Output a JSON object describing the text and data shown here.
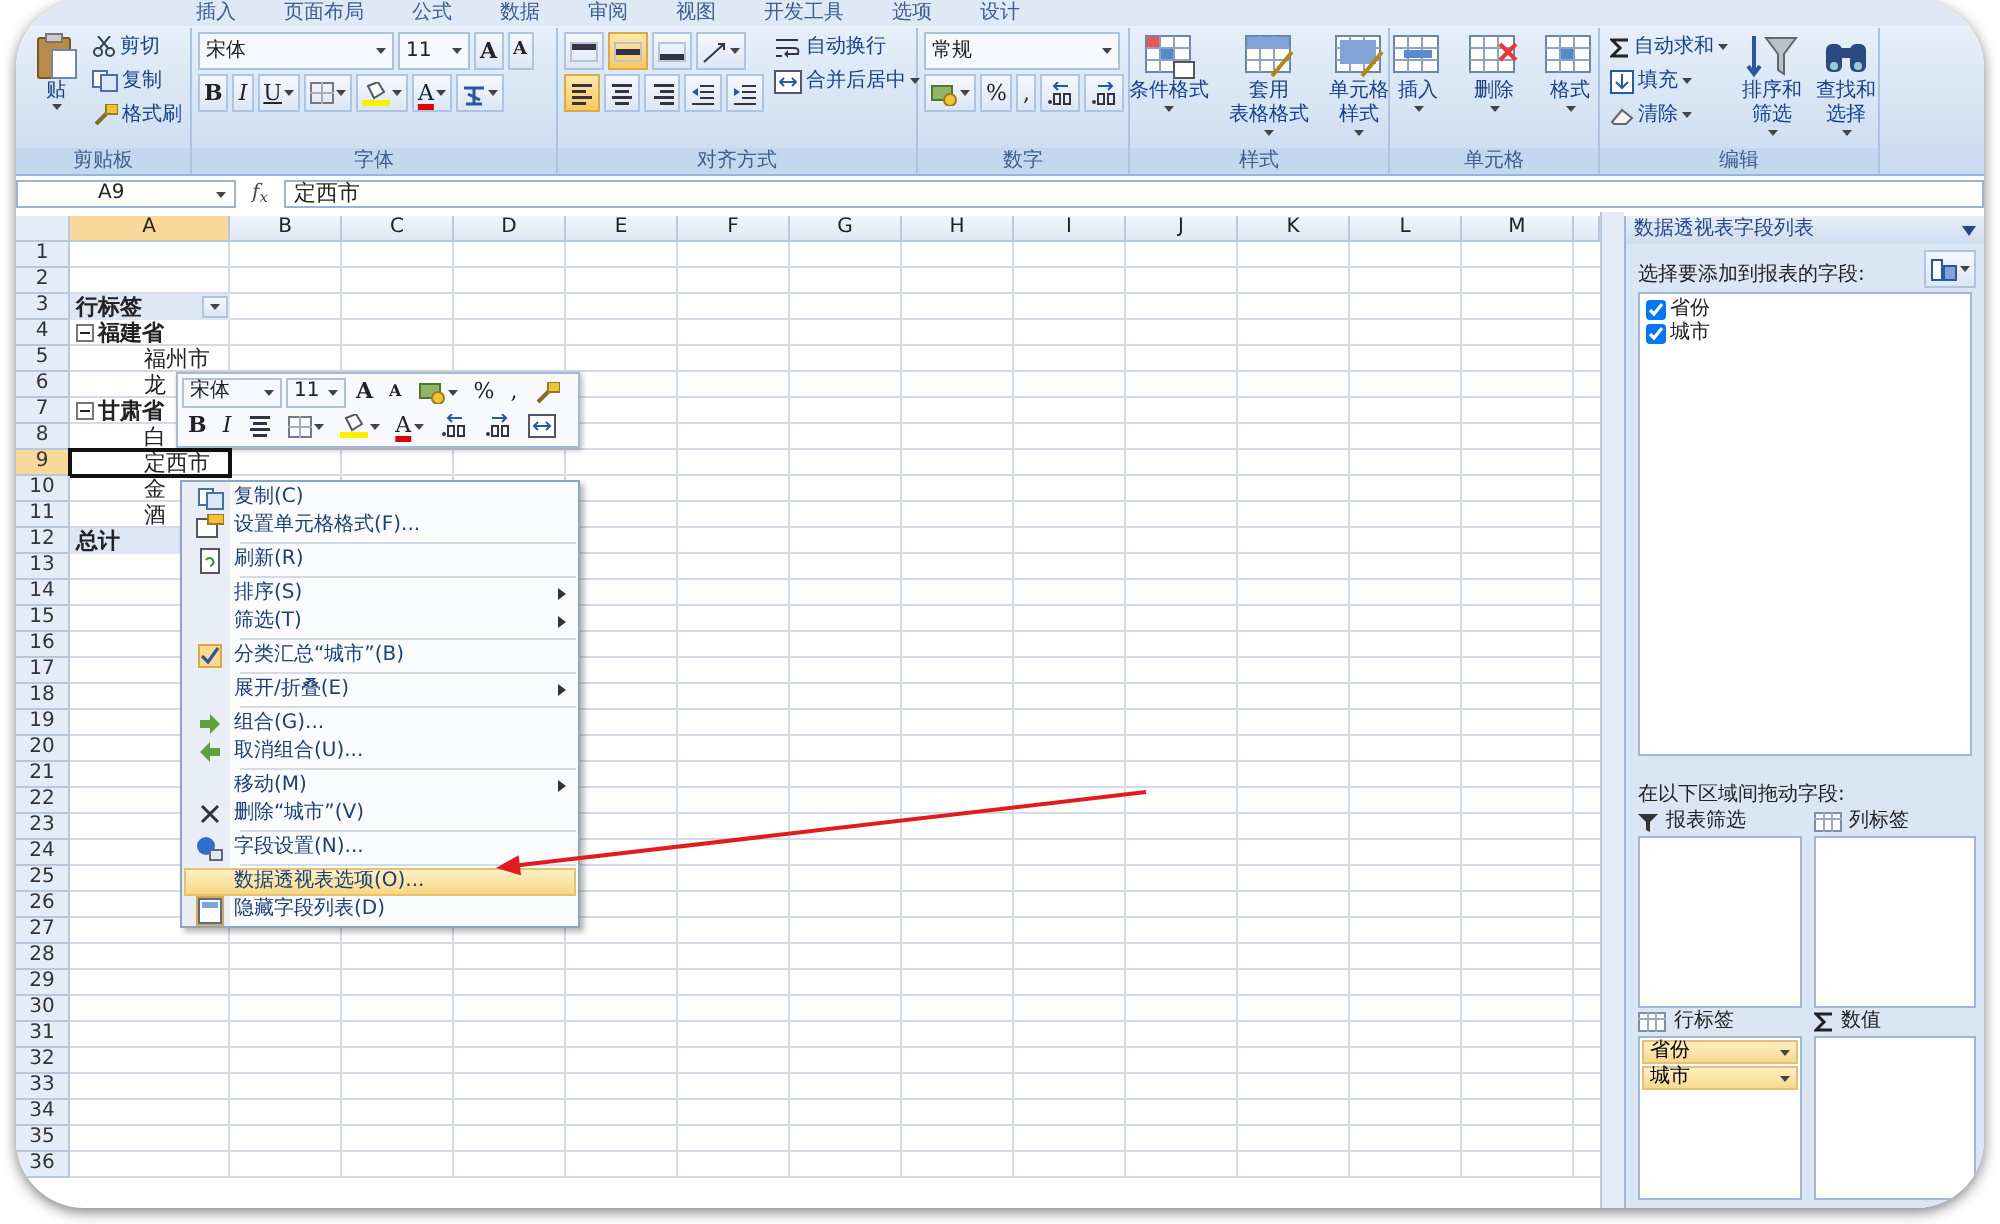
{
  "ribbon_tabs": [
    {
      "label": "插入",
      "selected": false
    },
    {
      "label": "页面布局",
      "selected": false
    },
    {
      "label": "公式",
      "selected": false
    },
    {
      "label": "数据",
      "selected": false
    },
    {
      "label": "审阅",
      "selected": false
    },
    {
      "label": "视图",
      "selected": false
    },
    {
      "label": "开发工具",
      "selected": false
    },
    {
      "label": "选项",
      "selected": false
    },
    {
      "label": "设计",
      "selected": false
    }
  ],
  "clipboard": {
    "label": "剪贴板",
    "paste": "贴",
    "cut": "剪切",
    "copy": "复制",
    "format_painter": "格式刷"
  },
  "font": {
    "label": "字体",
    "font_name": "宋体",
    "font_size": "11",
    "grow": "A",
    "shrink": "A",
    "bold": "B",
    "italic": "I",
    "underline": "U",
    "font_color_label": "A"
  },
  "alignment": {
    "label": "对齐方式",
    "wrap": "自动换行",
    "merge": "合并后居中",
    "vertical_align": [
      {
        "selected": false
      },
      {
        "selected": true
      },
      {
        "selected": false
      }
    ],
    "horizontal_align": [
      {
        "selected": true
      },
      {
        "selected": false
      },
      {
        "selected": false
      }
    ]
  },
  "number": {
    "label": "数字",
    "format": "常规",
    "percent": "%",
    "comma": ","
  },
  "styles": {
    "label": "样式",
    "buttons": [
      {
        "lines": [
          "条件格式"
        ]
      },
      {
        "lines": [
          "套用",
          "表格格式"
        ]
      },
      {
        "lines": [
          "单元格",
          "样式"
        ]
      }
    ]
  },
  "cells": {
    "label": "单元格",
    "buttons": [
      {
        "lines": [
          "插入"
        ]
      },
      {
        "lines": [
          "删除"
        ]
      },
      {
        "lines": [
          "格式"
        ]
      }
    ]
  },
  "editing": {
    "label": "编辑",
    "small": [
      "自动求和",
      "填充",
      "清除"
    ],
    "large": [
      {
        "lines": [
          "排序和",
          "筛选"
        ]
      },
      {
        "lines": [
          "查找和",
          "选择"
        ]
      }
    ]
  },
  "formula_bar": {
    "name_box": "A9",
    "fx": "f$_{x}$",
    "value": "定西市"
  },
  "sheet": {
    "columns": [
      {
        "label": "A",
        "selected": true
      },
      {
        "label": "B",
        "selected": false
      },
      {
        "label": "C",
        "selected": false
      },
      {
        "label": "D",
        "selected": false
      },
      {
        "label": "E",
        "selected": false
      },
      {
        "label": "F",
        "selected": false
      },
      {
        "label": "G",
        "selected": false
      },
      {
        "label": "H",
        "selected": false
      },
      {
        "label": "I",
        "selected": false
      },
      {
        "label": "J",
        "selected": false
      },
      {
        "label": "K",
        "selected": false
      },
      {
        "label": "L",
        "selected": false
      },
      {
        "label": "M",
        "selected": false
      }
    ],
    "rows": [
      {
        "number": "1",
        "selected": false
      },
      {
        "number": "2",
        "selected": false
      },
      {
        "number": "3",
        "selected": false
      },
      {
        "number": "4",
        "selected": false
      },
      {
        "number": "5",
        "selected": false
      },
      {
        "number": "6",
        "selected": false
      },
      {
        "number": "7",
        "selected": false
      },
      {
        "number": "8",
        "selected": false
      },
      {
        "number": "9",
        "selected": true
      },
      {
        "number": "10",
        "selected": false
      },
      {
        "number": "11",
        "selected": false
      },
      {
        "number": "12",
        "selected": false
      },
      {
        "number": "13",
        "selected": false
      },
      {
        "number": "14",
        "selected": false
      },
      {
        "number": "15",
        "selected": false
      },
      {
        "number": "16",
        "selected": false
      },
      {
        "number": "17",
        "selected": false
      },
      {
        "number": "18",
        "selected": false
      },
      {
        "number": "19",
        "selected": false
      },
      {
        "number": "20",
        "selected": false
      },
      {
        "number": "21",
        "selected": false
      },
      {
        "number": "22",
        "selected": false
      },
      {
        "number": "23",
        "selected": false
      },
      {
        "number": "24",
        "selected": false
      },
      {
        "number": "25",
        "selected": false
      },
      {
        "number": "26",
        "selected": false
      },
      {
        "number": "27",
        "selected": false
      },
      {
        "number": "28",
        "selected": false
      },
      {
        "number": "29",
        "selected": false
      },
      {
        "number": "30",
        "selected": false
      },
      {
        "number": "31",
        "selected": false
      },
      {
        "number": "32",
        "selected": false
      },
      {
        "number": "33",
        "selected": false
      },
      {
        "number": "34",
        "selected": false
      },
      {
        "number": "35",
        "selected": false
      },
      {
        "number": "36",
        "selected": false
      }
    ],
    "pivot": {
      "header": "行标签",
      "groups": [
        {
          "label": "福建省",
          "expanded": true,
          "children": [
            {
              "label": "福州市",
              "selected": false
            },
            {
              "label": "龙",
              "selected": false
            }
          ]
        },
        {
          "label": "甘肃省",
          "expanded": true,
          "children": [
            {
              "label": "白",
              "selected": false
            },
            {
              "label": "定西市",
              "selected": true
            },
            {
              "label": "金",
              "selected": false
            },
            {
              "label": "酒",
              "selected": false
            }
          ]
        }
      ],
      "total": "总计"
    }
  },
  "mini_toolbar": {
    "font_name": "宋体",
    "font_size": "11",
    "grow": "A",
    "shrink": "A",
    "percent": "%",
    "comma": ",",
    "bold": "B",
    "italic": "I",
    "font_color_label": "A"
  },
  "context_menu": {
    "sections": [
      [
        {
          "label": "复制(C)",
          "kind": "copy",
          "submenu": false,
          "checked": false,
          "selected": false
        },
        {
          "label": "设置单元格格式(F)...",
          "kind": "format",
          "submenu": false,
          "checked": false,
          "selected": false
        }
      ],
      [
        {
          "label": "刷新(R)",
          "kind": "refresh",
          "submenu": false,
          "checked": false,
          "selected": false
        }
      ],
      [
        {
          "label": "排序(S)",
          "kind": "none",
          "submenu": true,
          "checked": false,
          "selected": false
        },
        {
          "label": "筛选(T)",
          "kind": "none",
          "submenu": true,
          "checked": false,
          "selected": false
        }
      ],
      [
        {
          "label": "分类汇总“城市”(B)",
          "kind": "none",
          "submenu": false,
          "checked": true,
          "selected": false
        }
      ],
      [
        {
          "label": "展开/折叠(E)",
          "kind": "none",
          "submenu": true,
          "checked": false,
          "selected": false
        }
      ],
      [
        {
          "label": "组合(G)...",
          "kind": "group",
          "submenu": false,
          "checked": false,
          "selected": false
        },
        {
          "label": "取消组合(U)...",
          "kind": "ungroup",
          "submenu": false,
          "checked": false,
          "selected": false
        }
      ],
      [
        {
          "label": "移动(M)",
          "kind": "none",
          "submenu": true,
          "checked": false,
          "selected": false
        },
        {
          "label": "删除“城市”(V)",
          "kind": "delete",
          "submenu": false,
          "checked": false,
          "selected": false
        }
      ],
      [
        {
          "label": "字段设置(N)...",
          "kind": "field",
          "submenu": false,
          "checked": false,
          "selected": false
        }
      ],
      [
        {
          "label": "数据透视表选项(O)...",
          "kind": "none",
          "submenu": false,
          "checked": false,
          "selected": true
        },
        {
          "label": "隐藏字段列表(D)",
          "kind": "panel",
          "submenu": false,
          "checked": true,
          "selected": false
        }
      ]
    ]
  },
  "field_list": {
    "title": "数据透视表字段列表",
    "choose_label": "选择要添加到报表的字段:",
    "fields": [
      {
        "label": "省份",
        "checked": true
      },
      {
        "label": "城市",
        "checked": true
      }
    ],
    "drag_label": "在以下区域间拖动字段:",
    "areas": [
      {
        "label": "报表筛选",
        "kind": "filter"
      },
      {
        "label": "列标签",
        "kind": "columns"
      },
      {
        "label": "行标签",
        "kind": "rows",
        "items": [
          "省份",
          "城市"
        ]
      },
      {
        "label": "数值",
        "kind": "values"
      }
    ]
  }
}
